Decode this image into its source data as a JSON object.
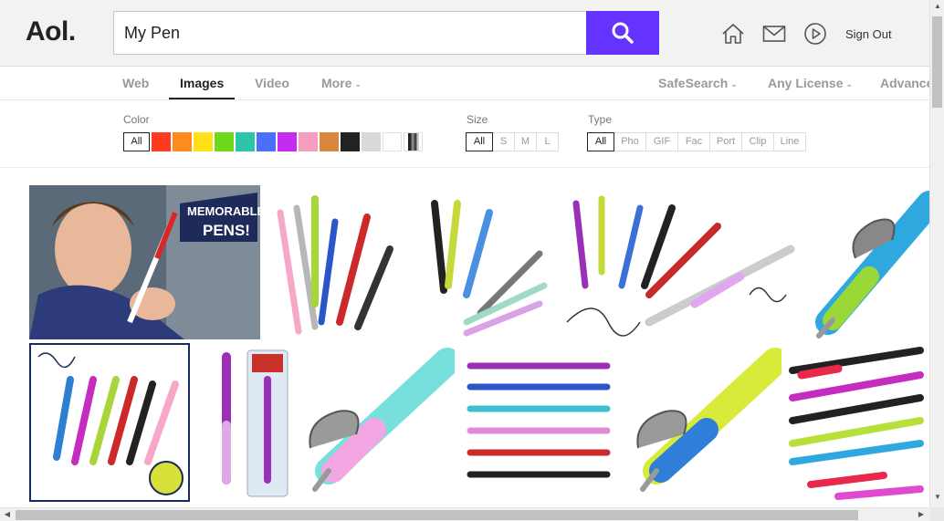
{
  "header": {
    "logo": "Aol.",
    "search_value": "My Pen",
    "signout_label": "Sign Out"
  },
  "nav": {
    "tabs": [
      {
        "label": "Web"
      },
      {
        "label": "Images"
      },
      {
        "label": "Video"
      },
      {
        "label": "More"
      }
    ],
    "active_tab": "Images",
    "right": [
      {
        "label": "SafeSearch"
      },
      {
        "label": "Any License"
      },
      {
        "label": "Advance"
      }
    ]
  },
  "filters": {
    "color_label": "Color",
    "color_all": "All",
    "colors": [
      "#ff3b1f",
      "#ff8a1d",
      "#ffe019",
      "#6ed81a",
      "#2cc5a9",
      "#4a6fff",
      "#c42ded",
      "#f79ec0",
      "#d9873c",
      "#222222",
      "#d9d9d9",
      "#ffffff"
    ],
    "size_label": "Size",
    "sizes": [
      "All",
      "S",
      "M",
      "L"
    ],
    "type_label": "Type",
    "types": [
      "All",
      "Pho",
      "GIF",
      "Fac",
      "Port",
      "Clip",
      "Line"
    ]
  },
  "results": {
    "thumb_captions": [
      "MEMORABLE",
      "PENS!"
    ]
  }
}
